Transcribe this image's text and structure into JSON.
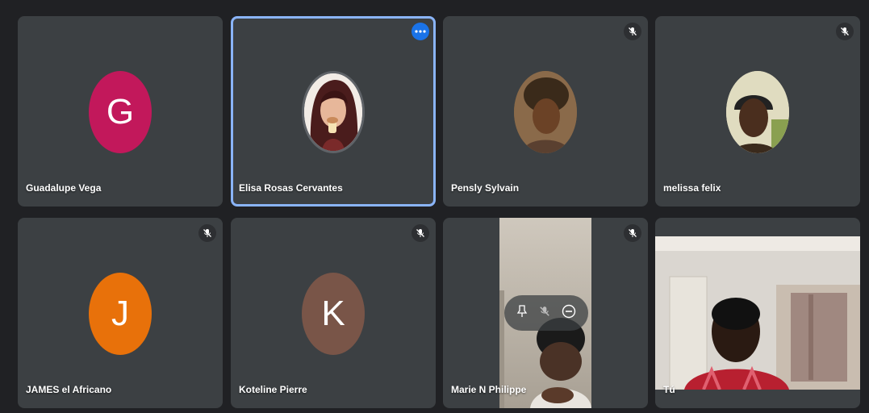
{
  "participants": [
    {
      "name": "Guadalupe Vega",
      "initial": "G",
      "avatar_color": "#c2185b",
      "muted": false
    },
    {
      "name": "Elisa Rosas Cervantes",
      "initial": "",
      "avatar_color": "",
      "muted": false,
      "active_speaker": true
    },
    {
      "name": "Pensly Sylvain",
      "initial": "",
      "avatar_color": "",
      "muted": true
    },
    {
      "name": "melissa felix",
      "initial": "",
      "avatar_color": "",
      "muted": true
    },
    {
      "name": "JAMES el Africano",
      "initial": "J",
      "avatar_color": "#e8710a",
      "muted": true
    },
    {
      "name": "Koteline Pierre",
      "initial": "K",
      "avatar_color": "#795548",
      "muted": true
    },
    {
      "name": "Marie N Philippe",
      "initial": "",
      "avatar_color": "",
      "muted": true,
      "video": true
    },
    {
      "name": "Tú",
      "initial": "",
      "avatar_color": "",
      "muted": false,
      "video": true,
      "self": true
    }
  ],
  "colors": {
    "background": "#202124",
    "tile": "#3c4043",
    "active_border": "#8ab4f8",
    "more_button": "#1a73e8"
  },
  "icons": {
    "mic_off": "mic-off-icon",
    "more": "more-options-icon",
    "pin": "pin-icon",
    "remove": "remove-icon"
  }
}
